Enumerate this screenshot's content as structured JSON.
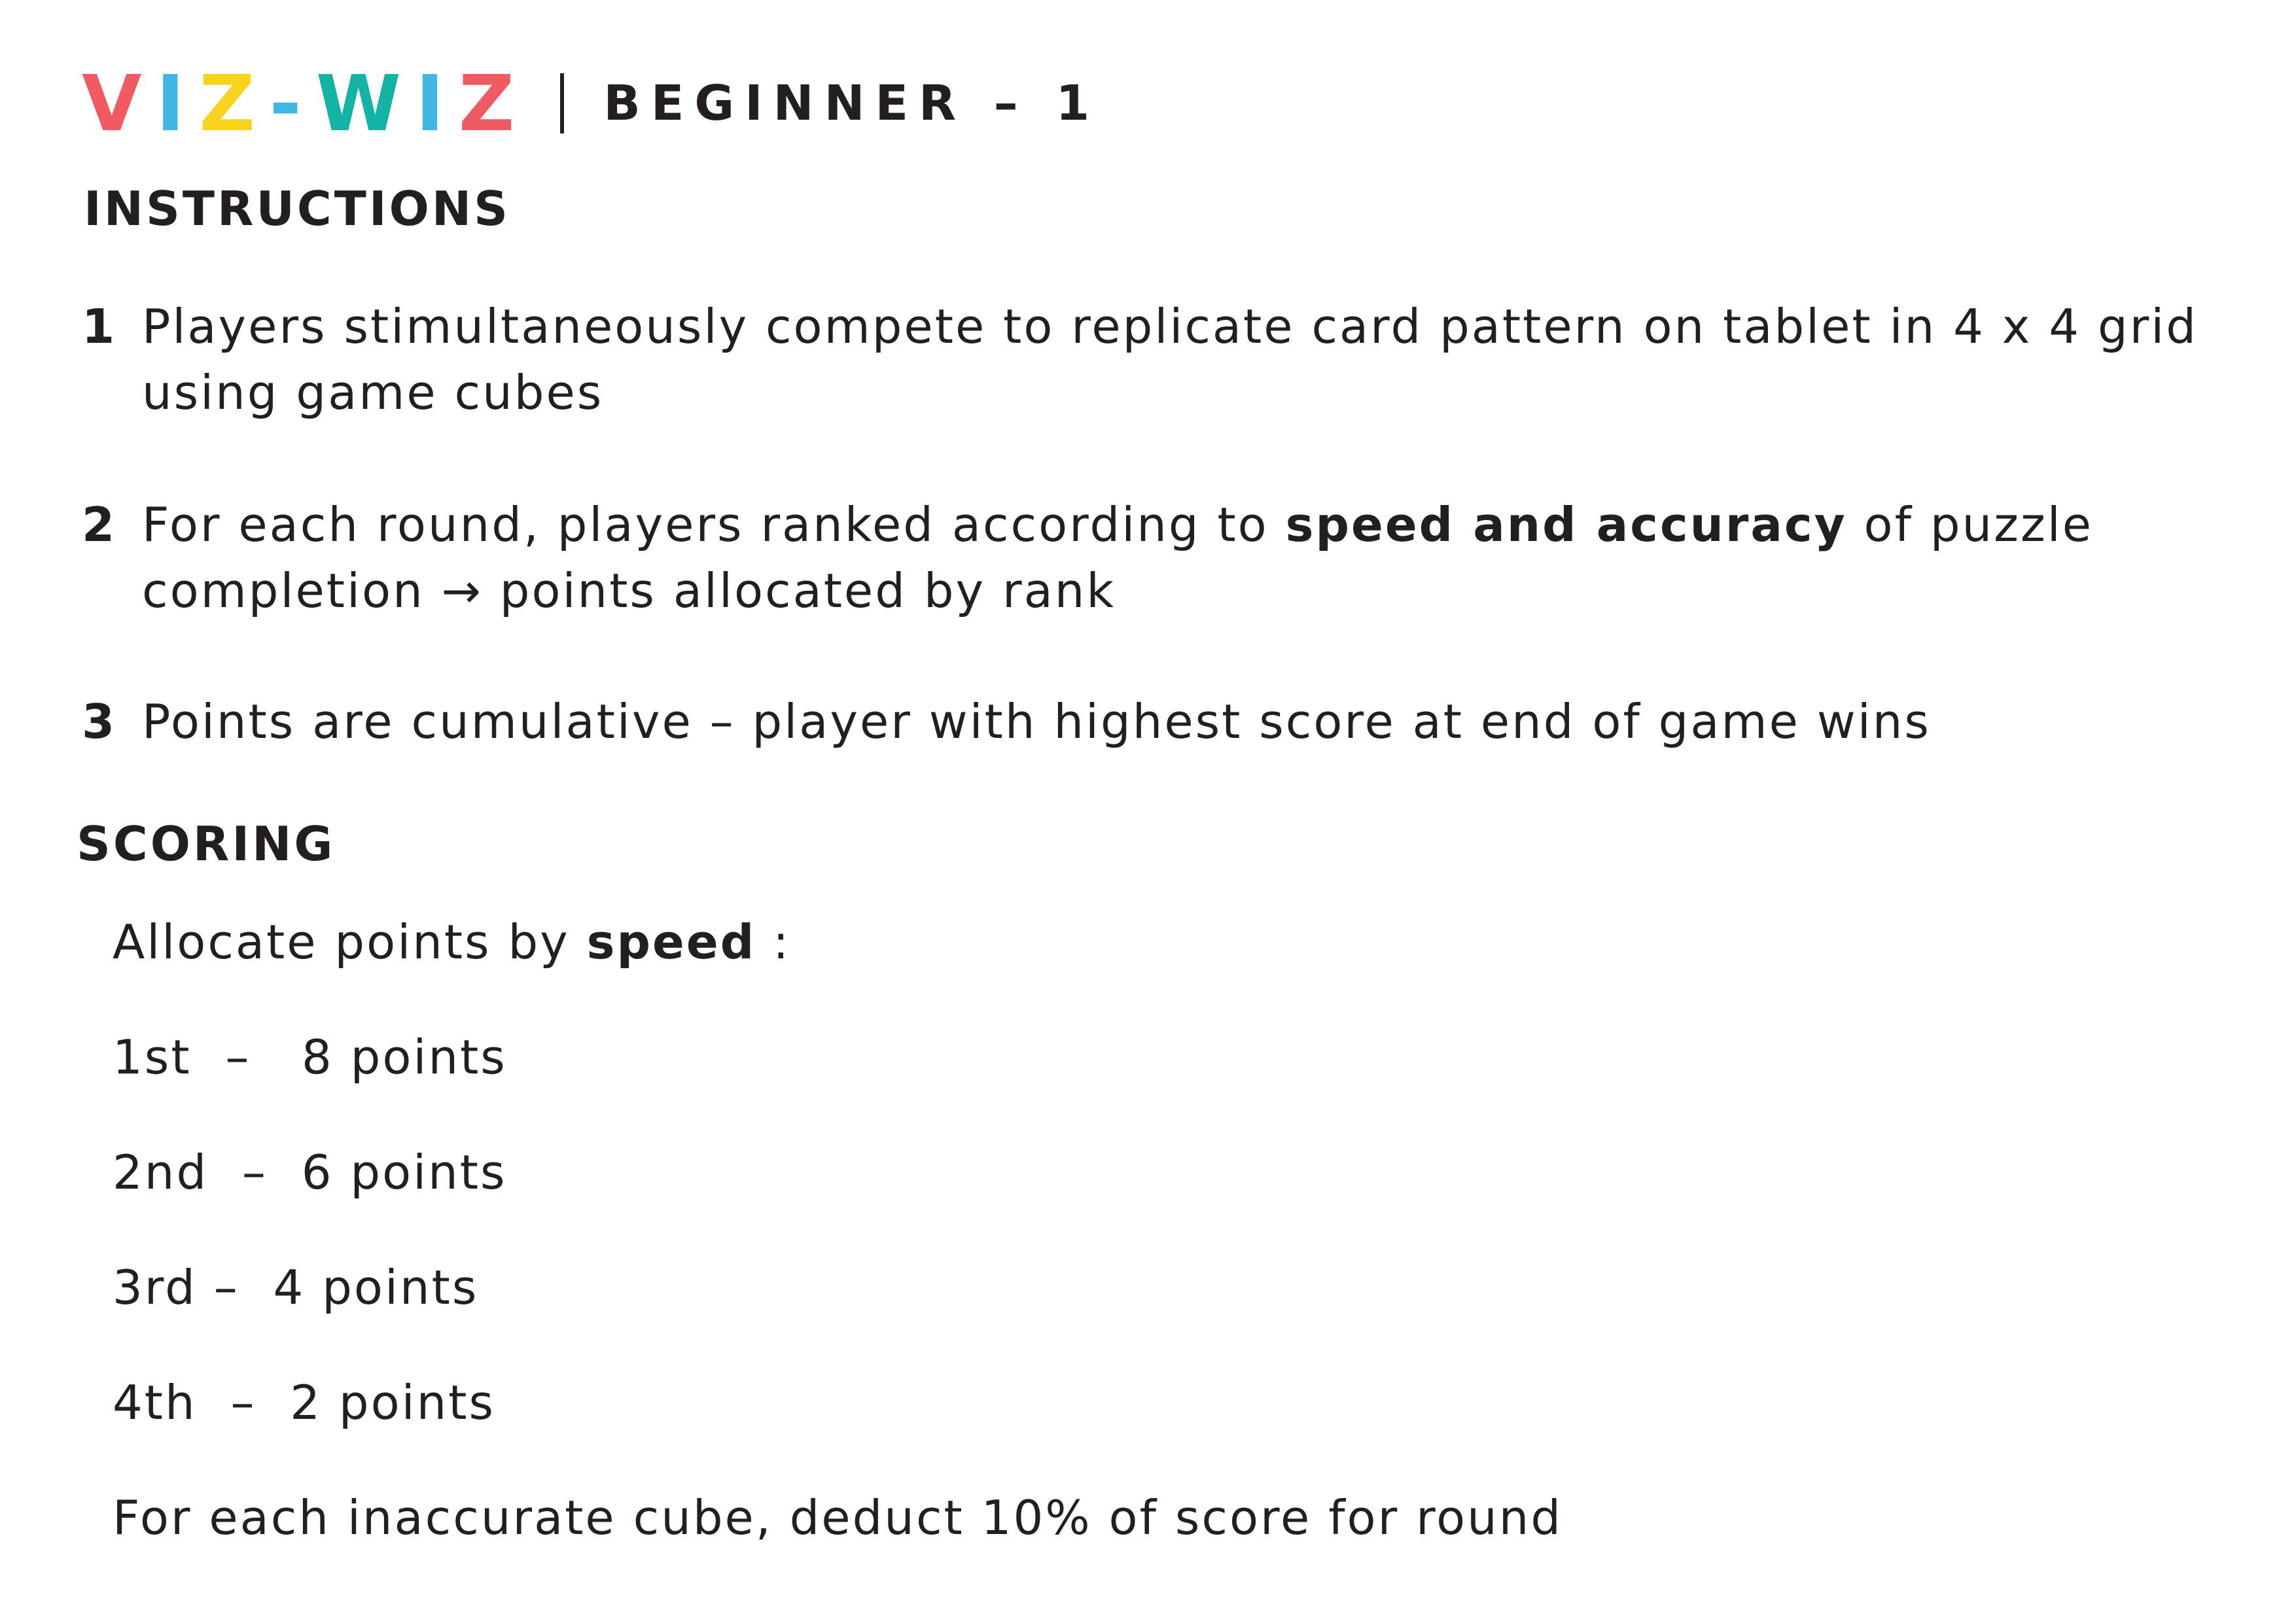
{
  "header": {
    "logo_letters": [
      {
        "char": "V",
        "color": "#ef5a63"
      },
      {
        "char": "I",
        "color": "#3fb6e4"
      },
      {
        "char": "Z",
        "color": "#f7d31b"
      },
      {
        "char": "-",
        "color": "#3fb6e4"
      },
      {
        "char": "W",
        "color": "#13b4a5"
      },
      {
        "char": "I",
        "color": "#3fb6e4"
      },
      {
        "char": "Z",
        "color": "#ef5a63"
      }
    ],
    "level": "BEGINNER – 1"
  },
  "instructions": {
    "heading": "INSTRUCTIONS",
    "items": [
      {
        "number": "1",
        "text": "Players stimultaneously compete to replicate card pattern on tablet in 4 x 4 grid using game cubes"
      },
      {
        "number": "2",
        "text_before": "For each round, players ranked according to ",
        "text_bold": "speed and accuracy",
        "text_after": " of puzzle completion → points allocated by rank"
      },
      {
        "number": "3",
        "text": "Points are cumulative – player with highest score at end of game wins"
      }
    ]
  },
  "scoring": {
    "heading": "SCORING",
    "intro_before": "Allocate points by ",
    "intro_bold": "speed",
    "intro_after": " :",
    "ranks": [
      {
        "text": "1st  –   8 points"
      },
      {
        "text": "2nd  –  6 points"
      },
      {
        "text": "3rd –  4 points"
      },
      {
        "text": "4th  –  2 points"
      }
    ],
    "penalty": "For each inaccurate cube, deduct 10% of score for round"
  },
  "colors": {
    "text": "#231f20",
    "red": "#ef5a63",
    "blue": "#3fb6e4",
    "yellow": "#f7d31b",
    "teal": "#13b4a5"
  }
}
